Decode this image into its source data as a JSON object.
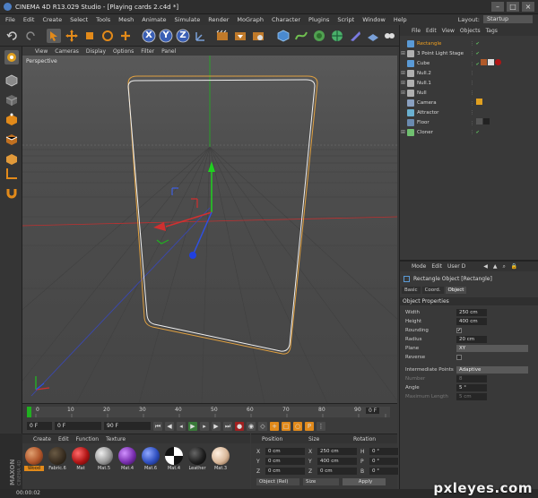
{
  "window": {
    "title": "CINEMA 4D R13.029 Studio - [Playing cards 2.c4d *]",
    "buttons": [
      "–",
      "□",
      "×"
    ]
  },
  "menubar": [
    "File",
    "Edit",
    "Create",
    "Select",
    "Tools",
    "Mesh",
    "Animate",
    "Simulate",
    "Render",
    "MoGraph",
    "Character",
    "Plugins",
    "Script",
    "Window",
    "Help"
  ],
  "layout": {
    "label": "Layout:",
    "value": "Startup"
  },
  "toolbar": {
    "axis_x": "X",
    "axis_y": "Y",
    "axis_z": "Z"
  },
  "viewport": {
    "menu": [
      "View",
      "Cameras",
      "Display",
      "Options",
      "Filter",
      "Panel"
    ],
    "label": "Perspective"
  },
  "timeline": {
    "ticks": [
      "0",
      "10",
      "20",
      "30",
      "40",
      "50",
      "60",
      "70",
      "80",
      "90"
    ],
    "start_field": "0 F",
    "current_field": "0 F",
    "end_field": "90 F",
    "frame_display": "0 F"
  },
  "material_manager": {
    "menu": [
      "Create",
      "Edit",
      "Function",
      "Texture"
    ],
    "materials": [
      {
        "label": "Wood",
        "color": "#b0552a"
      },
      {
        "label": "Fabric.6",
        "color": "#3a2f22"
      },
      {
        "label": "Mat",
        "color": "#b01515"
      },
      {
        "label": "Mat.5",
        "color": "#9a9a9a"
      },
      {
        "label": "Mat.4",
        "color": "#7a2fb0"
      },
      {
        "label": "Mat.6",
        "color": "#3050c0"
      },
      {
        "label": "Mat.4",
        "color": "#e8e8e8"
      },
      {
        "label": "Leather",
        "color": "#202020"
      },
      {
        "label": "Mat.3",
        "color": "#d9b89a"
      }
    ],
    "brand": "MAXON CINEMA 4D"
  },
  "coord_manager": {
    "headers": [
      "Position",
      "Size",
      "Rotation"
    ],
    "rows": [
      {
        "axis": "X",
        "pos": "0 cm",
        "size": "250 cm",
        "rot_axis": "H",
        "rot": "0 °"
      },
      {
        "axis": "Y",
        "pos": "0 cm",
        "size": "400 cm",
        "rot_axis": "P",
        "rot": "0 °"
      },
      {
        "axis": "Z",
        "pos": "0 cm",
        "size": "0 cm",
        "rot_axis": "B",
        "rot": "0 °"
      }
    ],
    "mode": "Object (Rel)",
    "size_mode": "Size",
    "apply": "Apply"
  },
  "status": {
    "time": "00:00:02"
  },
  "object_manager": {
    "menu": [
      "File",
      "Edit",
      "View",
      "Objects",
      "Tags"
    ],
    "objects": [
      {
        "name": "Rectangle",
        "expand": "",
        "color": "#5a9ad6",
        "selected": true
      },
      {
        "name": "3 Point Light Stage",
        "expand": "⊞",
        "color": "#b0b0b0",
        "selected": false
      },
      {
        "name": "Cube",
        "expand": "",
        "color": "#5a9ad6",
        "selected": false
      },
      {
        "name": "Null.2",
        "expand": "⊞",
        "color": "#b0b0b0",
        "selected": false
      },
      {
        "name": "Null.1",
        "expand": "⊞",
        "color": "#b0b0b0",
        "selected": false
      },
      {
        "name": "Null",
        "expand": "⊞",
        "color": "#b0b0b0",
        "selected": false
      },
      {
        "name": "Camera",
        "expand": "",
        "color": "#8aa0c0",
        "selected": false
      },
      {
        "name": "Attractor",
        "expand": "",
        "color": "#6ab0d0",
        "selected": false
      },
      {
        "name": "Floor",
        "expand": "",
        "color": "#6a8ab0",
        "selected": false
      },
      {
        "name": "Cloner",
        "expand": "⊞",
        "color": "#70c070",
        "selected": false
      }
    ]
  },
  "attribute_manager": {
    "menu": [
      "Mode",
      "Edit",
      "User D"
    ],
    "title": "Rectangle Object [Rectangle]",
    "tabs": [
      "Basic",
      "Coord.",
      "Object"
    ],
    "active_tab": "Object",
    "section": "Object Properties",
    "props": [
      {
        "label": "Width",
        "value": "250 cm",
        "kind": "num"
      },
      {
        "label": "Height",
        "value": "400 cm",
        "kind": "num"
      },
      {
        "label": "Rounding",
        "value": "✔",
        "kind": "check"
      },
      {
        "label": "Radius",
        "value": "20 cm",
        "kind": "num"
      },
      {
        "label": "Plane",
        "value": "XY",
        "kind": "drop"
      },
      {
        "label": "Reverse",
        "value": "",
        "kind": "check"
      },
      {
        "label": "Intermediate Points",
        "value": "Adaptive",
        "kind": "drop"
      },
      {
        "label": "Number",
        "value": "8",
        "kind": "numdim"
      },
      {
        "label": "Angle",
        "value": "5 °",
        "kind": "num"
      },
      {
        "label": "Maximum Length",
        "value": "5 cm",
        "kind": "numdim"
      }
    ]
  },
  "watermark": "pxleyes.com",
  "colors": {
    "accent": "#e28a1a",
    "selection": "#f0a020",
    "x_axis": "#d02020",
    "y_axis": "#20b020",
    "z_axis": "#2040d0"
  }
}
